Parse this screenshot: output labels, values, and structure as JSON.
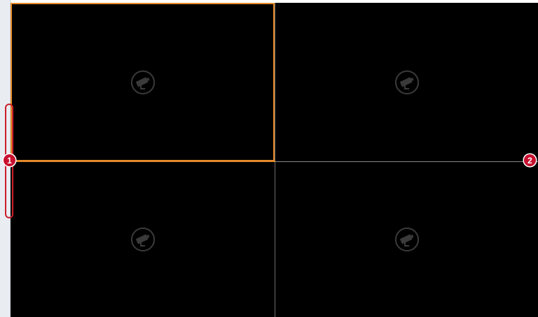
{
  "callouts": {
    "one": "1",
    "two": "2"
  },
  "panes": [
    {
      "icon": "camera-icon",
      "selected": true
    },
    {
      "icon": "camera-icon",
      "selected": false
    },
    {
      "icon": "camera-icon",
      "selected": false
    },
    {
      "icon": "camera-icon",
      "selected": false
    }
  ],
  "colors": {
    "selected_border": "#e58a2a",
    "callout": "#c8102e",
    "pane_bg": "#000000"
  }
}
